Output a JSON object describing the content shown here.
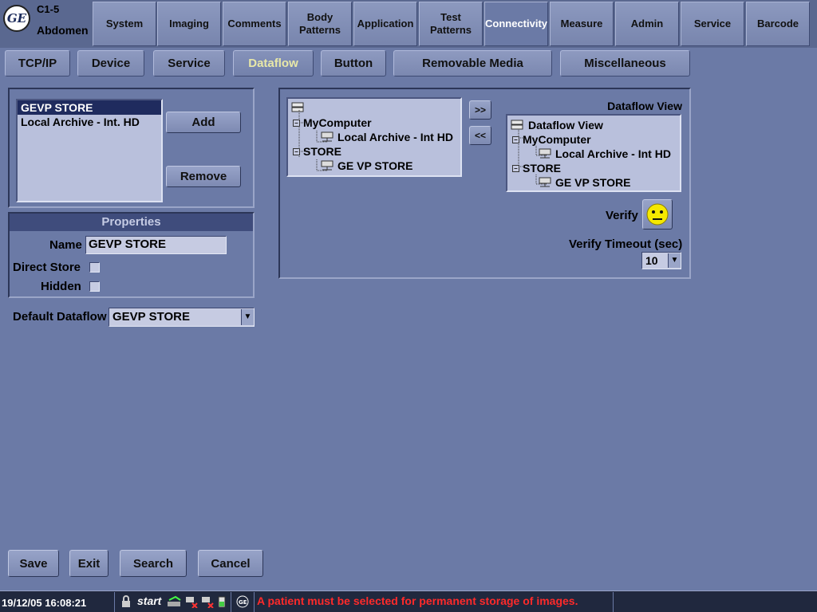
{
  "header": {
    "probe": "C1-5",
    "preset": "Abdomen",
    "tabs": [
      {
        "label": "System"
      },
      {
        "label": "Imaging"
      },
      {
        "label": "Comments"
      },
      {
        "label": "Body Patterns"
      },
      {
        "label": "Application"
      },
      {
        "label": "Test Patterns"
      },
      {
        "label": "Connectivity"
      },
      {
        "label": "Measure"
      },
      {
        "label": "Admin"
      },
      {
        "label": "Service"
      },
      {
        "label": "Barcode"
      }
    ],
    "active_tab": "Connectivity"
  },
  "subtabs": {
    "items": [
      {
        "label": "TCP/IP"
      },
      {
        "label": "Device"
      },
      {
        "label": "Service"
      },
      {
        "label": "Dataflow"
      },
      {
        "label": "Button"
      },
      {
        "label": "Removable Media"
      },
      {
        "label": "Miscellaneous"
      }
    ],
    "active": "Dataflow"
  },
  "dataflow_list": {
    "items": [
      {
        "label": "GEVP STORE",
        "selected": true
      },
      {
        "label": "Local Archive - Int. HD",
        "selected": false
      }
    ],
    "add_label": "Add",
    "remove_label": "Remove"
  },
  "properties": {
    "header": "Properties",
    "name_label": "Name",
    "name_value": "GEVP STORE",
    "direct_store_label": "Direct Store",
    "direct_store_checked": false,
    "hidden_label": "Hidden",
    "hidden_checked": false
  },
  "default_dataflow": {
    "label": "Default Dataflow",
    "value": "GEVP STORE"
  },
  "available_tree": {
    "nodes": [
      {
        "label": "MyComputer"
      },
      {
        "label": "Local Archive - Int HD"
      },
      {
        "label": "STORE"
      },
      {
        "label": "GE VP STORE"
      }
    ]
  },
  "move_buttons": {
    "add": ">>",
    "remove": "<<"
  },
  "dataflow_view": {
    "title": "Dataflow View",
    "root": "Dataflow View",
    "nodes": [
      {
        "label": "MyComputer"
      },
      {
        "label": "Local Archive - Int HD"
      },
      {
        "label": "STORE"
      },
      {
        "label": "GE VP STORE"
      }
    ],
    "verify_label": "Verify",
    "verify_timeout_label": "Verify Timeout (sec)",
    "verify_timeout_value": "10"
  },
  "bottom_buttons": {
    "save": "Save",
    "exit": "Exit",
    "search": "Search",
    "cancel": "Cancel"
  },
  "statusbar": {
    "datetime": "19/12/05 16:08:21",
    "start": "start",
    "message": "A patient must be selected for permanent storage of images."
  },
  "colors": {
    "background": "#6b7aa6",
    "status_message": "#ff2a2a",
    "selection": "#1f2b5e",
    "verify_face": "#f5e800"
  }
}
